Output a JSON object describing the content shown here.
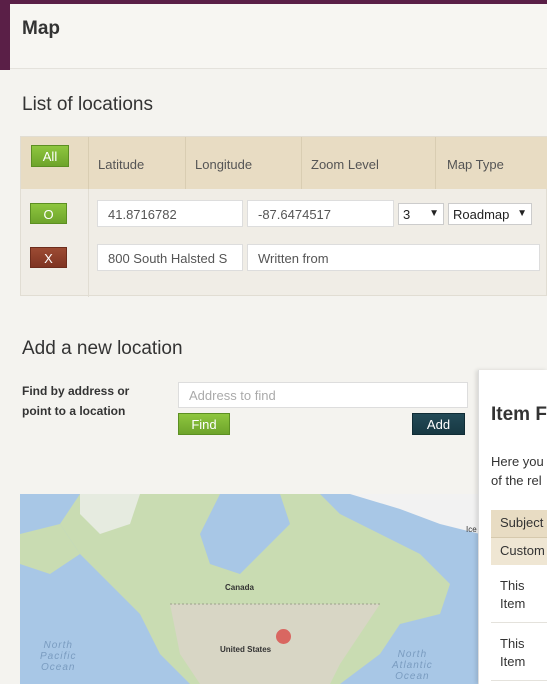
{
  "header": {
    "title": "Map"
  },
  "locations_section": {
    "title": "List of locations",
    "all_button": "All",
    "columns": [
      "Latitude",
      "Longitude",
      "Zoom Level",
      "Map Type"
    ],
    "rows": [
      {
        "button": "O",
        "latitude": "41.8716782",
        "longitude": "-87.6474517",
        "zoom": "3",
        "map_type": "Roadmap"
      },
      {
        "button": "X",
        "address": "800 South Halsted S",
        "note": "Written from"
      }
    ]
  },
  "add_section": {
    "title": "Add a new location",
    "label_line1": "Find by address or",
    "label_line2": "point to a location",
    "address_placeholder": "Address to find",
    "find_button": "Find",
    "add_button": "Add"
  },
  "map": {
    "labels": {
      "canada": "Canada",
      "united_states": "United States",
      "north_pacific": [
        "North",
        "Pacific",
        "Ocean"
      ],
      "north_atlantic": [
        "North",
        "Atlantic",
        "Ocean"
      ],
      "ice": "Ice"
    }
  },
  "item_panel": {
    "title": "Item F",
    "desc_line1": "Here you",
    "desc_line2": "of the rel",
    "header1": "Subject",
    "header2": "Custom",
    "rows": [
      {
        "line1": "This",
        "line2": "Item"
      },
      {
        "line1": "This",
        "line2": "Item"
      }
    ]
  },
  "colors": {
    "brand": "#5a1f47",
    "green": "#7ab535",
    "red": "#8c3f2b",
    "dark": "#1d414d",
    "table_header": "#e8dcc3"
  }
}
